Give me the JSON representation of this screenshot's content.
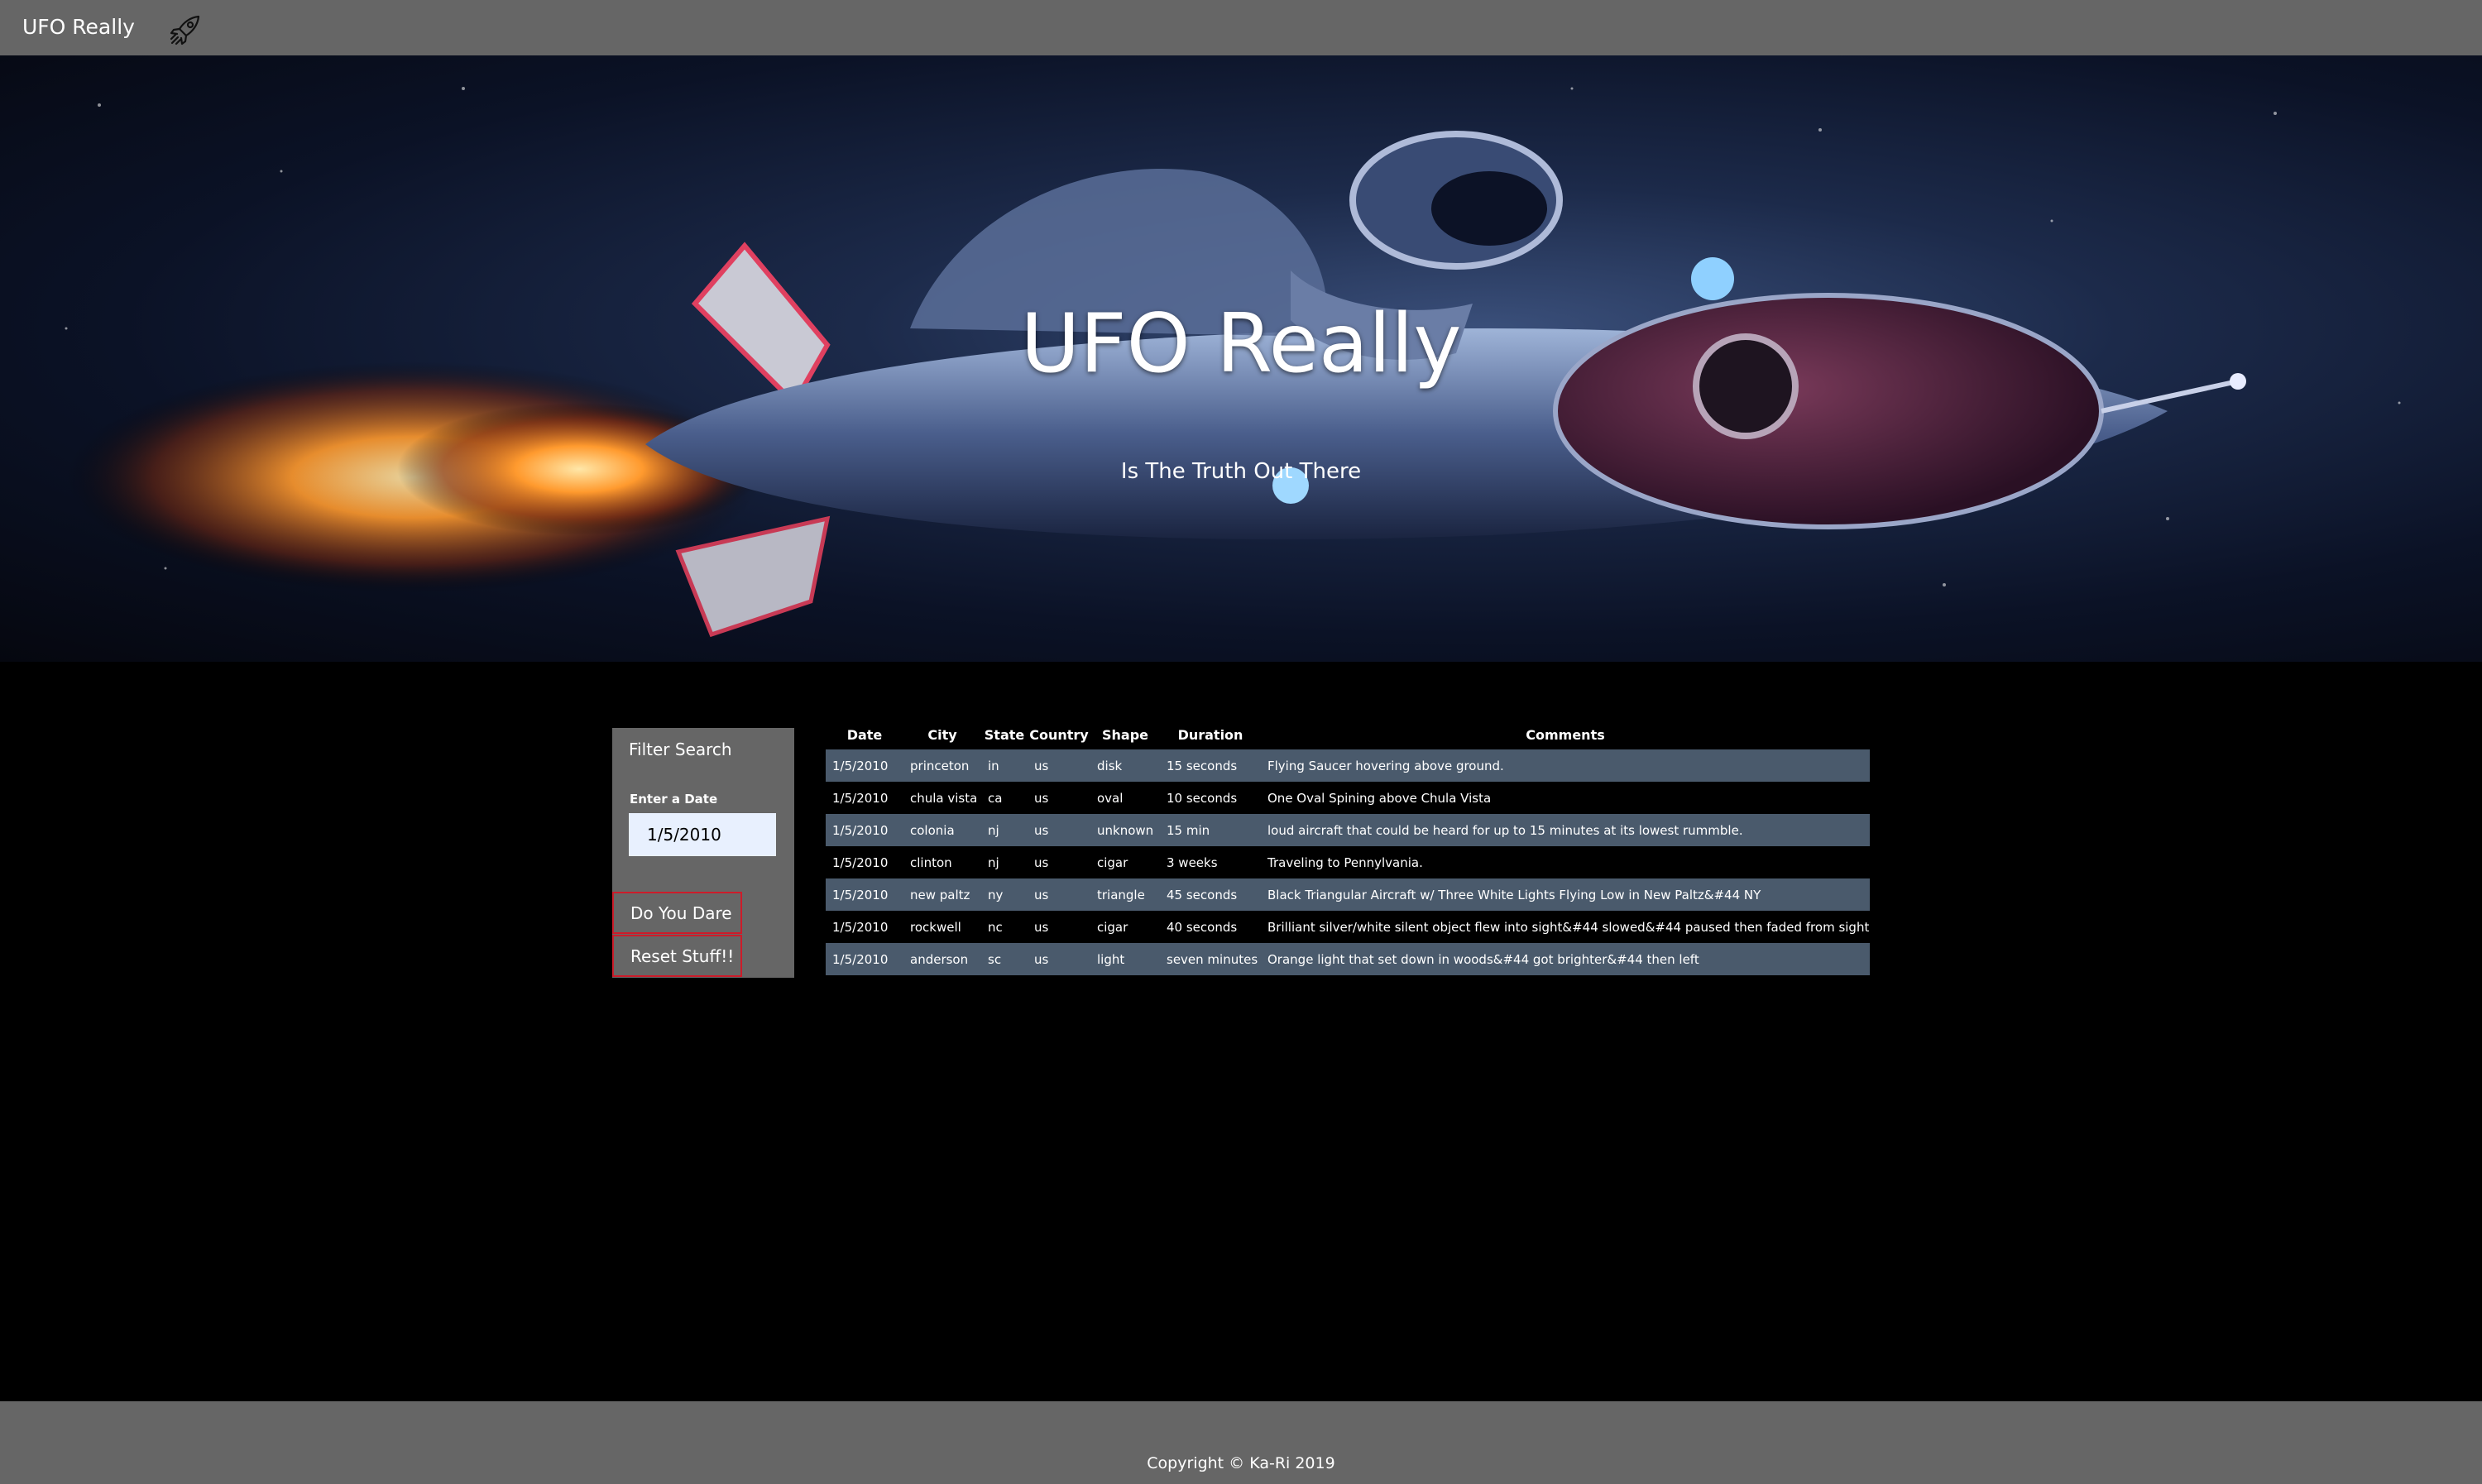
{
  "navbar": {
    "brand": "UFO Really",
    "icon": "rocket-icon"
  },
  "hero": {
    "title": "UFO Really",
    "subtitle": "Is The Truth Out There"
  },
  "filter": {
    "title": "Filter Search",
    "date_label": "Enter a Date",
    "date_value": "1/5/2010",
    "filter_button": "Do You Dare",
    "reset_button": "Reset Stuff!!",
    "button_border_color": "#cc1c2a"
  },
  "table": {
    "headers": [
      "Date",
      "City",
      "State",
      "Country",
      "Shape",
      "Duration",
      "Comments"
    ],
    "rows": [
      [
        "1/5/2010",
        "princeton",
        "in",
        "us",
        "disk",
        "15 seconds",
        "Flying Saucer hovering above ground."
      ],
      [
        "1/5/2010",
        "chula vista",
        "ca",
        "us",
        "oval",
        "10 seconds",
        "One Oval Spining above Chula Vista"
      ],
      [
        "1/5/2010",
        "colonia",
        "nj",
        "us",
        "unknown",
        "15 min",
        "loud aircraft that could be heard for up to 15 minutes at its lowest rummble."
      ],
      [
        "1/5/2010",
        "clinton",
        "nj",
        "us",
        "cigar",
        "3 weeks",
        "Traveling to Pennylvania."
      ],
      [
        "1/5/2010",
        "new paltz",
        "ny",
        "us",
        "triangle",
        "45 seconds",
        "Black Triangular Aircraft w/ Three White Lights Flying Low in New Paltz&#44 NY"
      ],
      [
        "1/5/2010",
        "rockwell",
        "nc",
        "us",
        "cigar",
        "40 seconds",
        "Brilliant silver/white silent object flew into sight&#44 slowed&#44 paused then faded from sight."
      ],
      [
        "1/5/2010",
        "anderson",
        "sc",
        "us",
        "light",
        "seven minutes",
        "Orange light that set down in woods&#44 got brighter&#44 then left"
      ]
    ],
    "stripe_color": "#4a5a6c"
  },
  "footer": {
    "copyright": "Copyright © Ka-Ri 2019"
  }
}
